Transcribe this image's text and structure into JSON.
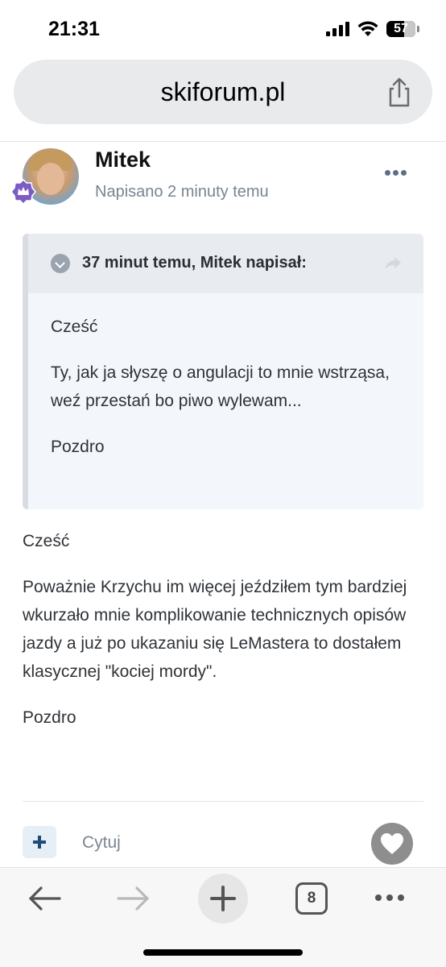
{
  "status_bar": {
    "time": "21:31",
    "battery": "57",
    "icons": [
      "signal-icon",
      "wifi-icon",
      "battery-icon"
    ]
  },
  "browser": {
    "url": "skiforum.pl",
    "share_icon": "share-icon"
  },
  "post": {
    "author": "Mitek",
    "meta": "Napisano 2 minuty temu",
    "quote": {
      "citation": "37 minut temu, Mitek napisał:",
      "paragraphs": [
        "Cześć",
        "Ty, jak ja słyszę o angulacji to mnie wstrząsa, weź przestań bo piwo wylewam...",
        "Pozdro"
      ]
    },
    "body": {
      "paragraphs": [
        "Cześć",
        "Poważnie Krzychu im więcej jeździłem tym bardziej wkurzało mnie komplikowanie technicznych opisów jazdy a już po ukazaniu się LeMastera to dostałem klasycznej \"kociej mordy\".",
        "Pozdro"
      ]
    },
    "actions": {
      "quote_label": "Cytuj"
    }
  },
  "toolbar": {
    "tab_count": "8",
    "icons": [
      "back-arrow-icon",
      "forward-arrow-icon",
      "new-tab-plus-icon",
      "tabs-icon",
      "more-icon"
    ]
  },
  "colors": {
    "accent": "#1f4b7a",
    "muted_text": "#7a8491",
    "quote_background": "#f3f6fa"
  }
}
